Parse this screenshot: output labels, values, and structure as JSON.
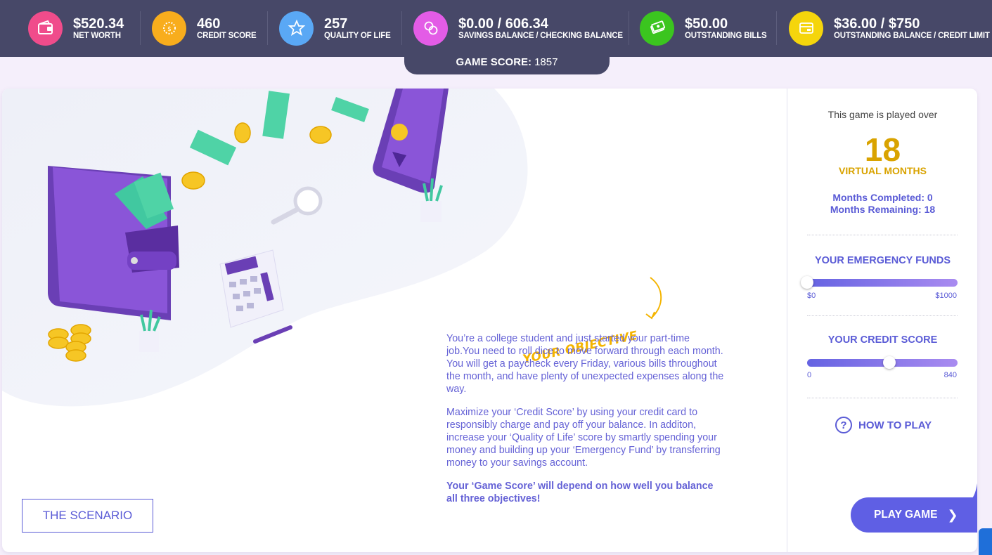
{
  "stats": [
    {
      "value": "$520.34",
      "label": "NET WORTH",
      "color": "#f04c8b",
      "icon": "wallet-icon"
    },
    {
      "value": "460",
      "label": "CREDIT SCORE",
      "color": "#f8ad1d",
      "icon": "gauge-icon"
    },
    {
      "value": "257",
      "label": "QUALITY OF LIFE",
      "color": "#5aa8f5",
      "icon": "star-icon"
    },
    {
      "value": "$0.00 / 606.34",
      "label": "SAVINGS BALANCE / CHECKING BALANCE",
      "color": "#e35ce6",
      "icon": "coins-icon"
    },
    {
      "value": "$50.00",
      "label": "OUTSTANDING BILLS",
      "color": "#3bc51f",
      "icon": "cash-icon"
    },
    {
      "value": "$36.00 / $750",
      "label": "OUTSTANDING BALANCE / CREDIT LIMIT",
      "color": "#f5d50c",
      "icon": "credit-card-icon"
    }
  ],
  "game_score": {
    "label": "GAME SCORE:",
    "value": "1857"
  },
  "objective": {
    "title": "YOUR OBJECTIVE",
    "para1": "You’re a college student and just started your part-time job.You need to roll dice to move forward through each month. You will get a paycheck every Friday, various bills throughout the month, and have plenty of unexpected expenses along the way.",
    "para2": "Maximize your ‘Credit Score’ by using your credit card to responsibly charge and pay off your balance. In additon, increase your ‘Quality of Life’ score by smartly spending your money and building up your ‘Emergency Fund’ by transferring money to your savings account.",
    "para3": "Your ‘Game Score’ will depend on how well you balance all three objectives!"
  },
  "scenario_button": "THE SCENARIO",
  "panel": {
    "played_over": "This game is played over",
    "months": "18",
    "months_label": "VIRTUAL MONTHS",
    "completed": "Months Completed: 0",
    "remaining": "Months Remaining: 18",
    "emergency": {
      "title": "YOUR EMERGENCY FUNDS",
      "min": "$0",
      "max": "$1000",
      "level": 0.0
    },
    "credit": {
      "title": "YOUR CREDIT SCORE",
      "min": "0",
      "max": "840",
      "level": 0.5476
    },
    "how_to_play": "HOW TO PLAY",
    "play_game": "PLAY GAME"
  }
}
